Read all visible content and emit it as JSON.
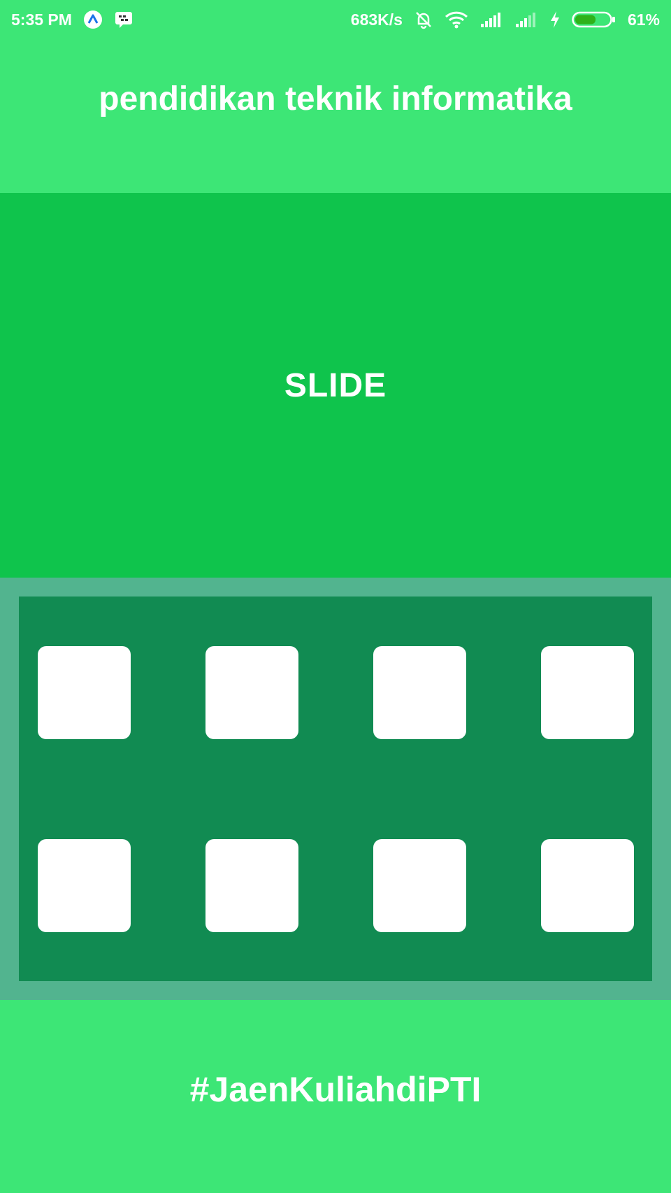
{
  "status_bar": {
    "time": "5:35 PM",
    "left_icons": [
      "arrow-launcher-icon",
      "bbm-icon"
    ],
    "network_speed": "683K/s",
    "right_icons": [
      "muted-bell-icon",
      "wifi-icon",
      "signal-icon",
      "signal-icon",
      "charging-icon",
      "battery-icon"
    ],
    "battery_level": 0.61,
    "battery_percent": "61%"
  },
  "header": {
    "title": "pendidikan teknik informatika"
  },
  "slide": {
    "label": "SLIDE"
  },
  "menu": {
    "rows": 2,
    "columns": 4,
    "tile_count": 8
  },
  "footer": {
    "hashtag": "#JaenKuliahdiPTI"
  },
  "colors": {
    "background": "#3de676",
    "slide": "#0fc44c",
    "menu_frame": "#52b48f",
    "menu_panel": "#118b52",
    "tile": "#ffffff",
    "text": "#ffffff"
  }
}
